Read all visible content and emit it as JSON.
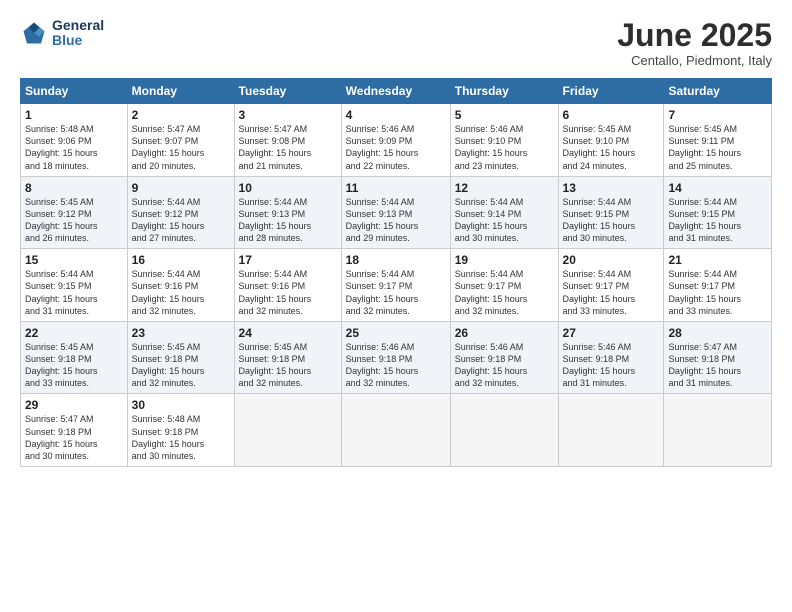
{
  "logo": {
    "line1": "General",
    "line2": "Blue"
  },
  "title": "June 2025",
  "subtitle": "Centallo, Piedmont, Italy",
  "weekdays": [
    "Sunday",
    "Monday",
    "Tuesday",
    "Wednesday",
    "Thursday",
    "Friday",
    "Saturday"
  ],
  "weeks": [
    [
      {
        "day": 1,
        "info": "Sunrise: 5:48 AM\nSunset: 9:06 PM\nDaylight: 15 hours\nand 18 minutes."
      },
      {
        "day": 2,
        "info": "Sunrise: 5:47 AM\nSunset: 9:07 PM\nDaylight: 15 hours\nand 20 minutes."
      },
      {
        "day": 3,
        "info": "Sunrise: 5:47 AM\nSunset: 9:08 PM\nDaylight: 15 hours\nand 21 minutes."
      },
      {
        "day": 4,
        "info": "Sunrise: 5:46 AM\nSunset: 9:09 PM\nDaylight: 15 hours\nand 22 minutes."
      },
      {
        "day": 5,
        "info": "Sunrise: 5:46 AM\nSunset: 9:10 PM\nDaylight: 15 hours\nand 23 minutes."
      },
      {
        "day": 6,
        "info": "Sunrise: 5:45 AM\nSunset: 9:10 PM\nDaylight: 15 hours\nand 24 minutes."
      },
      {
        "day": 7,
        "info": "Sunrise: 5:45 AM\nSunset: 9:11 PM\nDaylight: 15 hours\nand 25 minutes."
      }
    ],
    [
      {
        "day": 8,
        "info": "Sunrise: 5:45 AM\nSunset: 9:12 PM\nDaylight: 15 hours\nand 26 minutes."
      },
      {
        "day": 9,
        "info": "Sunrise: 5:44 AM\nSunset: 9:12 PM\nDaylight: 15 hours\nand 27 minutes."
      },
      {
        "day": 10,
        "info": "Sunrise: 5:44 AM\nSunset: 9:13 PM\nDaylight: 15 hours\nand 28 minutes."
      },
      {
        "day": 11,
        "info": "Sunrise: 5:44 AM\nSunset: 9:13 PM\nDaylight: 15 hours\nand 29 minutes."
      },
      {
        "day": 12,
        "info": "Sunrise: 5:44 AM\nSunset: 9:14 PM\nDaylight: 15 hours\nand 30 minutes."
      },
      {
        "day": 13,
        "info": "Sunrise: 5:44 AM\nSunset: 9:15 PM\nDaylight: 15 hours\nand 30 minutes."
      },
      {
        "day": 14,
        "info": "Sunrise: 5:44 AM\nSunset: 9:15 PM\nDaylight: 15 hours\nand 31 minutes."
      }
    ],
    [
      {
        "day": 15,
        "info": "Sunrise: 5:44 AM\nSunset: 9:15 PM\nDaylight: 15 hours\nand 31 minutes."
      },
      {
        "day": 16,
        "info": "Sunrise: 5:44 AM\nSunset: 9:16 PM\nDaylight: 15 hours\nand 32 minutes."
      },
      {
        "day": 17,
        "info": "Sunrise: 5:44 AM\nSunset: 9:16 PM\nDaylight: 15 hours\nand 32 minutes."
      },
      {
        "day": 18,
        "info": "Sunrise: 5:44 AM\nSunset: 9:17 PM\nDaylight: 15 hours\nand 32 minutes."
      },
      {
        "day": 19,
        "info": "Sunrise: 5:44 AM\nSunset: 9:17 PM\nDaylight: 15 hours\nand 32 minutes."
      },
      {
        "day": 20,
        "info": "Sunrise: 5:44 AM\nSunset: 9:17 PM\nDaylight: 15 hours\nand 33 minutes."
      },
      {
        "day": 21,
        "info": "Sunrise: 5:44 AM\nSunset: 9:17 PM\nDaylight: 15 hours\nand 33 minutes."
      }
    ],
    [
      {
        "day": 22,
        "info": "Sunrise: 5:45 AM\nSunset: 9:18 PM\nDaylight: 15 hours\nand 33 minutes."
      },
      {
        "day": 23,
        "info": "Sunrise: 5:45 AM\nSunset: 9:18 PM\nDaylight: 15 hours\nand 32 minutes."
      },
      {
        "day": 24,
        "info": "Sunrise: 5:45 AM\nSunset: 9:18 PM\nDaylight: 15 hours\nand 32 minutes."
      },
      {
        "day": 25,
        "info": "Sunrise: 5:46 AM\nSunset: 9:18 PM\nDaylight: 15 hours\nand 32 minutes."
      },
      {
        "day": 26,
        "info": "Sunrise: 5:46 AM\nSunset: 9:18 PM\nDaylight: 15 hours\nand 32 minutes."
      },
      {
        "day": 27,
        "info": "Sunrise: 5:46 AM\nSunset: 9:18 PM\nDaylight: 15 hours\nand 31 minutes."
      },
      {
        "day": 28,
        "info": "Sunrise: 5:47 AM\nSunset: 9:18 PM\nDaylight: 15 hours\nand 31 minutes."
      }
    ],
    [
      {
        "day": 29,
        "info": "Sunrise: 5:47 AM\nSunset: 9:18 PM\nDaylight: 15 hours\nand 30 minutes."
      },
      {
        "day": 30,
        "info": "Sunrise: 5:48 AM\nSunset: 9:18 PM\nDaylight: 15 hours\nand 30 minutes."
      },
      null,
      null,
      null,
      null,
      null
    ]
  ]
}
